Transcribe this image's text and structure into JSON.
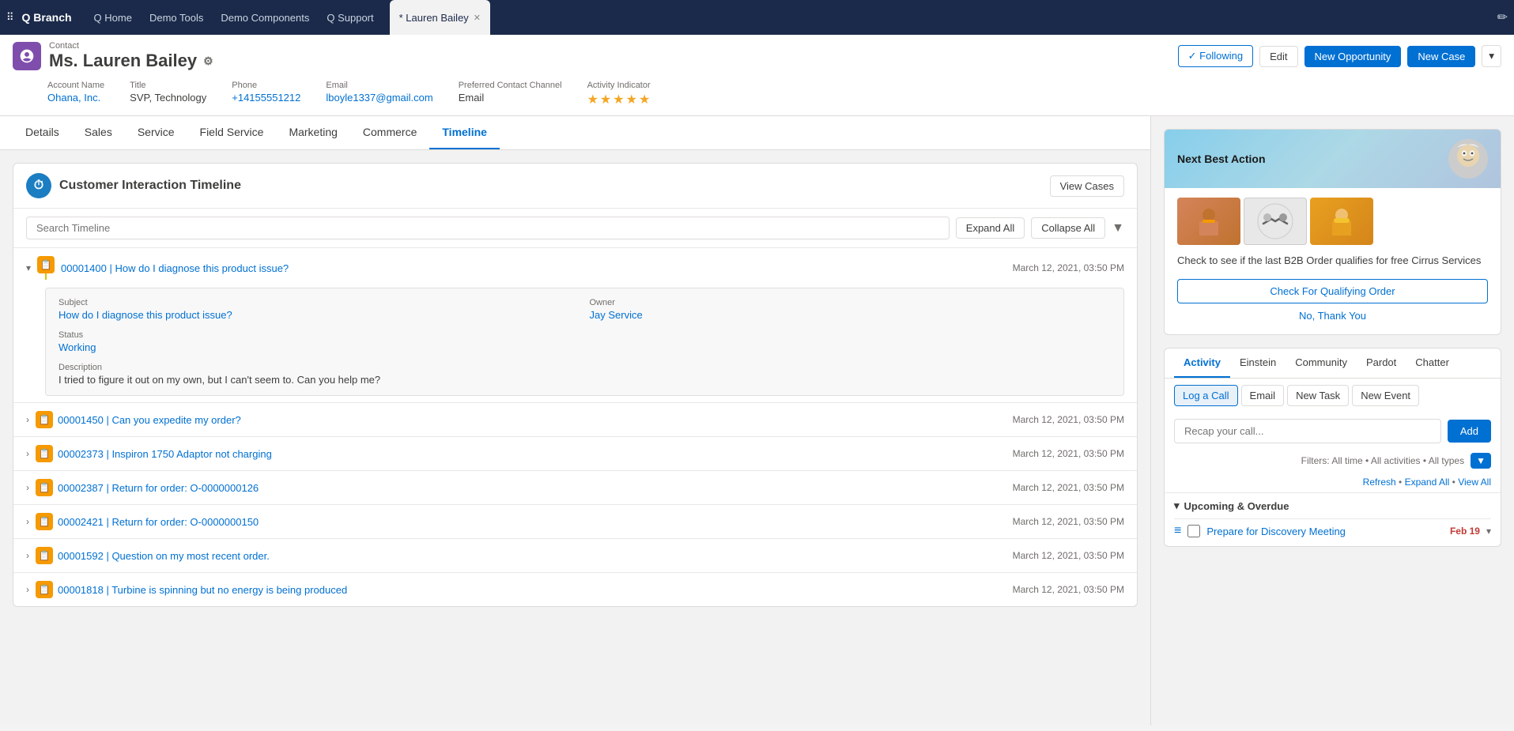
{
  "nav": {
    "app_name": "Q Branch",
    "links": [
      "Q Home",
      "Demo Tools",
      "Demo Components",
      "Q Support"
    ],
    "active_tab": "* Lauren Bailey",
    "tab_star": "*",
    "pencil_icon": "✏"
  },
  "record": {
    "type": "Contact",
    "name": "Ms. Lauren Bailey",
    "admin_icon": "⚙",
    "fields": {
      "account_name_label": "Account Name",
      "account_name": "Ohana, Inc.",
      "title_label": "Title",
      "title": "SVP, Technology",
      "phone_label": "Phone",
      "phone": "+14155551212",
      "email_label": "Email",
      "email": "lboyle1337@gmail.com",
      "preferred_contact_label": "Preferred Contact Channel",
      "preferred_contact": "Email",
      "activity_indicator_label": "Activity Indicator",
      "stars": "★★★★★"
    },
    "actions": {
      "following": "✓ Following",
      "edit": "Edit",
      "new_opportunity": "New Opportunity",
      "new_case": "New Case",
      "dropdown": "▾"
    }
  },
  "tabs": [
    "Details",
    "Sales",
    "Service",
    "Field Service",
    "Marketing",
    "Commerce",
    "Timeline"
  ],
  "active_tab_main": "Timeline",
  "timeline": {
    "title": "Customer Interaction Timeline",
    "view_cases": "View Cases",
    "search_placeholder": "Search Timeline",
    "expand_all": "Expand All",
    "collapse_all": "Collapse All",
    "cases": [
      {
        "id": "00001400",
        "subject": "How do I diagnose this product issue?",
        "date": "March 12, 2021, 03:50 PM",
        "expanded": true,
        "detail": {
          "subject_label": "Subject",
          "subject_value": "How do I diagnose this product issue?",
          "owner_label": "Owner",
          "owner_value": "Jay Service",
          "status_label": "Status",
          "status_value": "Working",
          "description_label": "Description",
          "description_value": "I tried to figure it out on my own, but I can't seem to. Can you help me?"
        }
      },
      {
        "id": "00001450",
        "subject": "Can you expedite my order?",
        "date": "March 12, 2021, 03:50 PM",
        "expanded": false
      },
      {
        "id": "00002373",
        "subject": "Inspiron 1750 Adaptor not charging",
        "date": "March 12, 2021, 03:50 PM",
        "expanded": false
      },
      {
        "id": "00002387",
        "subject": "Return for order: O-0000000126",
        "date": "March 12, 2021, 03:50 PM",
        "expanded": false
      },
      {
        "id": "00002421",
        "subject": "Return for order: O-0000000150",
        "date": "March 12, 2021, 03:50 PM",
        "expanded": false
      },
      {
        "id": "00001592",
        "subject": "Question on my most recent order.",
        "date": "March 12, 2021, 03:50 PM",
        "expanded": false
      },
      {
        "id": "00001818",
        "subject": "Turbine is spinning but no energy is being produced",
        "date": "March 12, 2021, 03:50 PM",
        "expanded": false
      }
    ]
  },
  "nba": {
    "title": "Next Best Action",
    "description": "Check to see if the last B2B Order qualifies for free Cirrus Services",
    "check_btn": "Check For Qualifying Order",
    "no_thanks_btn": "No, Thank You"
  },
  "activity": {
    "tabs": [
      "Activity",
      "Einstein",
      "Community",
      "Pardot",
      "Chatter"
    ],
    "active_tab": "Activity",
    "sub_tabs": [
      "Log a Call",
      "Email",
      "New Task",
      "New Event"
    ],
    "active_sub_tab": "Log a Call",
    "recap_placeholder": "Recap your call...",
    "add_btn": "Add",
    "filters_text": "Filters: All time • All activities • All types",
    "refresh": "Refresh",
    "expand_all": "Expand All",
    "view_all": "View All",
    "upcoming_label": "Upcoming & Overdue",
    "upcoming_items": [
      {
        "task": "Prepare for Discovery Meeting",
        "date": "Feb 19"
      }
    ]
  }
}
